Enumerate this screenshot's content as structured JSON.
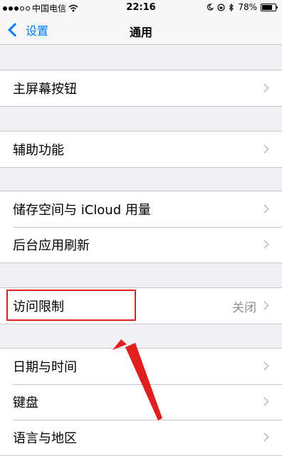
{
  "status_bar": {
    "carrier": "中国电信",
    "time": "22:16",
    "battery_percent": "78%",
    "battery_level": 0.78
  },
  "nav": {
    "back_label": "设置",
    "title": "通用"
  },
  "sections": [
    {
      "items": [
        {
          "label": "主屏幕按钮"
        }
      ]
    },
    {
      "items": [
        {
          "label": "辅助功能"
        }
      ]
    },
    {
      "items": [
        {
          "label": "储存空间与 iCloud 用量"
        },
        {
          "label": "后台应用刷新"
        }
      ]
    },
    {
      "items": [
        {
          "label": "访问限制",
          "value": "关闭"
        }
      ]
    },
    {
      "items": [
        {
          "label": "日期与时间"
        },
        {
          "label": "键盘"
        },
        {
          "label": "语言与地区"
        }
      ]
    }
  ],
  "annotation": {
    "color": "#e02020"
  },
  "colors": {
    "accent": "#007aff",
    "background": "#efeff4"
  }
}
